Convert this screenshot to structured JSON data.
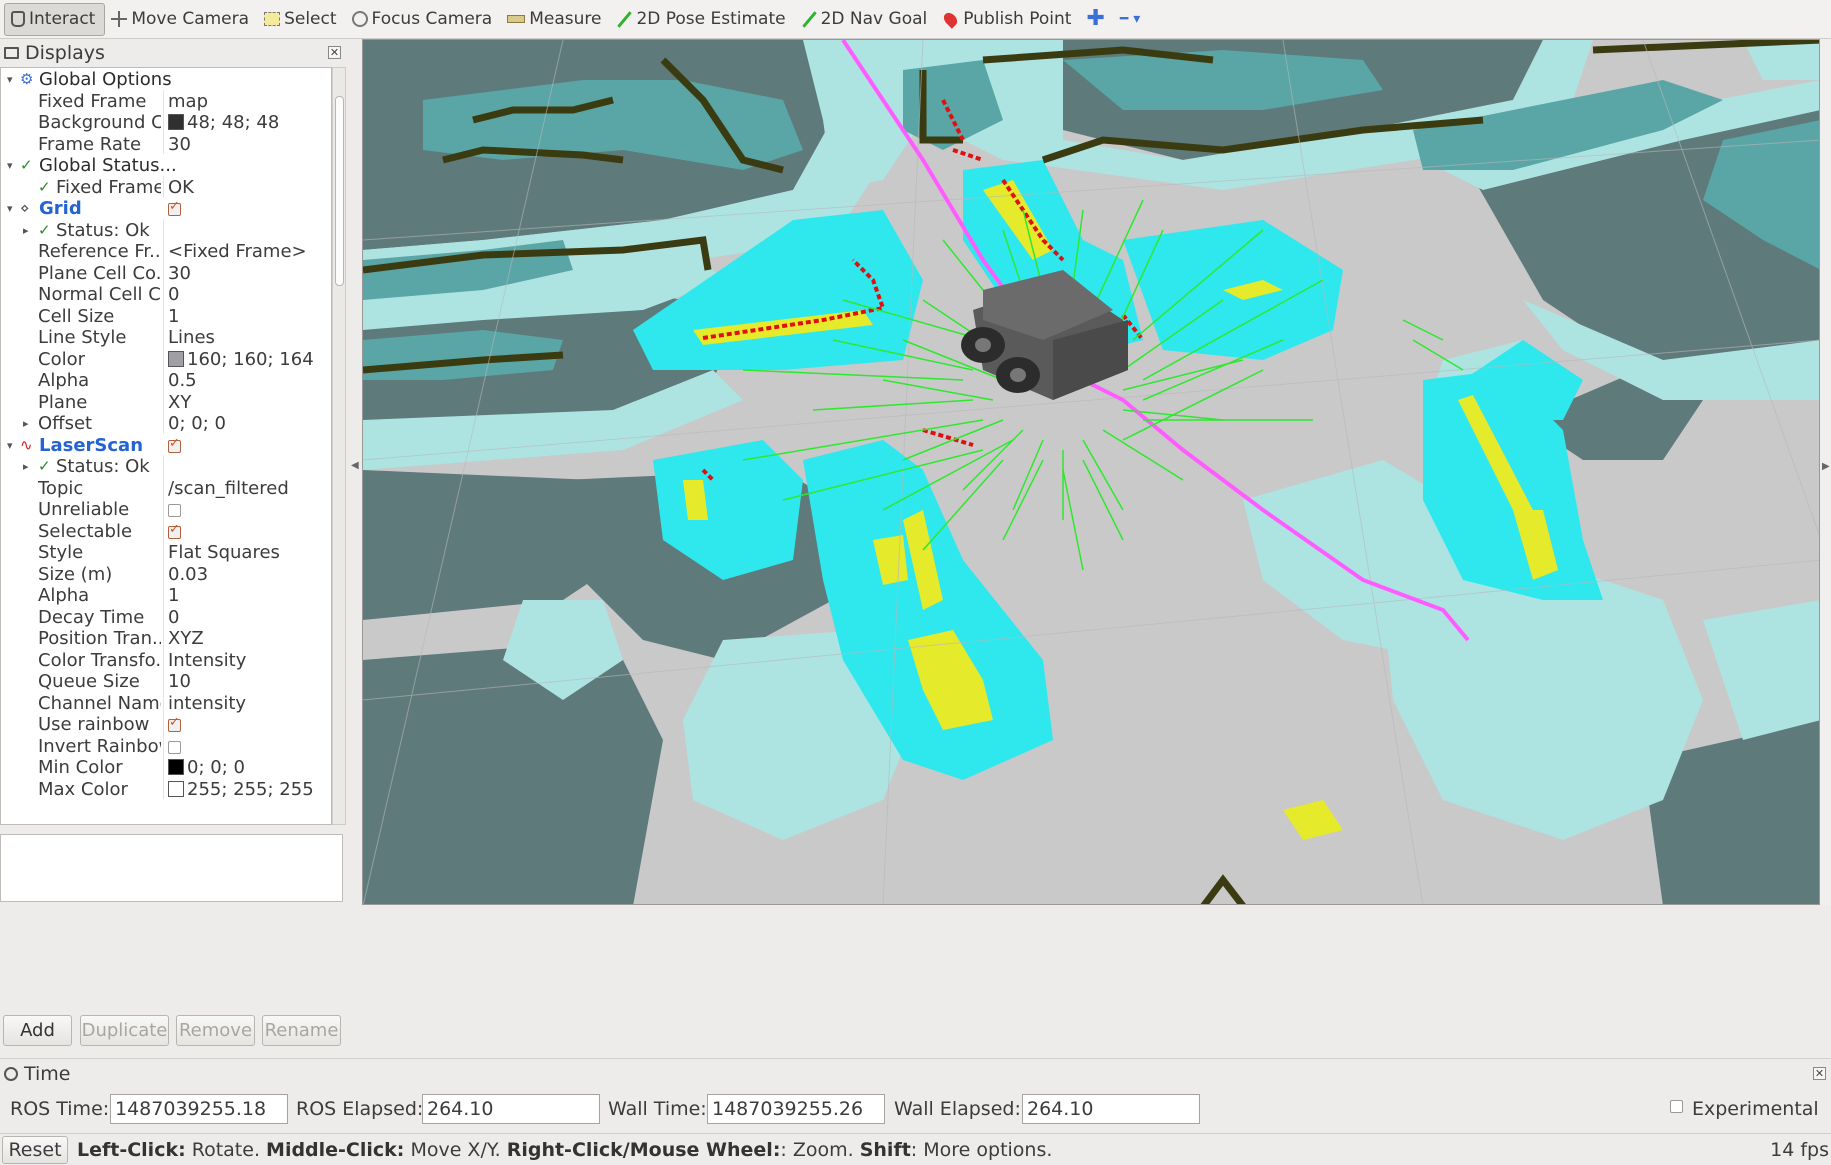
{
  "toolbar": {
    "tools": [
      {
        "label": "Interact",
        "icon": "hand-icon"
      },
      {
        "label": "Move Camera",
        "icon": "move-camera-icon"
      },
      {
        "label": "Select",
        "icon": "select-icon"
      },
      {
        "label": "Focus Camera",
        "icon": "focus-camera-icon"
      },
      {
        "label": "Measure",
        "icon": "measure-icon"
      },
      {
        "label": "2D Pose Estimate",
        "icon": "pose-arrow-icon"
      },
      {
        "label": "2D Nav Goal",
        "icon": "nav-goal-arrow-icon"
      },
      {
        "label": "Publish Point",
        "icon": "point-pin-icon"
      }
    ],
    "add_symbol": "✚",
    "remove_symbol": "━ ▾"
  },
  "displays": {
    "title": "Displays",
    "rows": [
      {
        "level": 0,
        "expanded": true,
        "icon": "⚙",
        "name": "Global Options",
        "value": ""
      },
      {
        "level": 1,
        "name": "Fixed Frame",
        "value": "map"
      },
      {
        "level": 1,
        "name": "Background C...",
        "swatch": "#303030",
        "value": "48; 48; 48"
      },
      {
        "level": 1,
        "name": "Frame Rate",
        "value": "30"
      },
      {
        "level": 0,
        "expanded": true,
        "icon": "✓",
        "name": "Global Status...",
        "value": ""
      },
      {
        "level": 1,
        "icon": "✓",
        "name": "Fixed Frame",
        "value": "OK"
      },
      {
        "level": 0,
        "expanded": true,
        "icon": "⋄",
        "name": "Grid",
        "blue": true,
        "checkbox": true
      },
      {
        "level": 1,
        "expandable": true,
        "icon": "✓",
        "name": "Status: Ok",
        "value": ""
      },
      {
        "level": 1,
        "name": "Reference Fr...",
        "value": "<Fixed Frame>"
      },
      {
        "level": 1,
        "name": "Plane Cell Co...",
        "value": "30"
      },
      {
        "level": 1,
        "name": "Normal Cell C...",
        "value": "0"
      },
      {
        "level": 1,
        "name": "Cell Size",
        "value": "1"
      },
      {
        "level": 1,
        "name": "Line Style",
        "value": "Lines"
      },
      {
        "level": 1,
        "name": "Color",
        "swatch": "#a0a0a4",
        "value": "160; 160; 164"
      },
      {
        "level": 1,
        "name": "Alpha",
        "value": "0.5"
      },
      {
        "level": 1,
        "name": "Plane",
        "value": "XY"
      },
      {
        "level": 1,
        "expandable": true,
        "name": "Offset",
        "value": "0; 0; 0"
      },
      {
        "level": 0,
        "expanded": true,
        "icon": "∿",
        "name": "LaserScan",
        "blue": true,
        "checkbox": true
      },
      {
        "level": 1,
        "expandable": true,
        "icon": "✓",
        "name": "Status: Ok",
        "value": ""
      },
      {
        "level": 1,
        "name": "Topic",
        "value": "/scan_filtered"
      },
      {
        "level": 1,
        "name": "Unreliable",
        "checkbox": false
      },
      {
        "level": 1,
        "name": "Selectable",
        "checkbox": true
      },
      {
        "level": 1,
        "name": "Style",
        "value": "Flat Squares"
      },
      {
        "level": 1,
        "name": "Size (m)",
        "value": "0.03"
      },
      {
        "level": 1,
        "name": "Alpha",
        "value": "1"
      },
      {
        "level": 1,
        "name": "Decay Time",
        "value": "0"
      },
      {
        "level": 1,
        "name": "Position Tran...",
        "value": "XYZ"
      },
      {
        "level": 1,
        "name": "Color Transfo...",
        "value": "Intensity"
      },
      {
        "level": 1,
        "name": "Queue Size",
        "value": "10"
      },
      {
        "level": 1,
        "name": "Channel Name",
        "value": "intensity"
      },
      {
        "level": 1,
        "name": "Use rainbow",
        "checkbox": true
      },
      {
        "level": 1,
        "name": "Invert Rainbow",
        "checkbox": false
      },
      {
        "level": 1,
        "name": "Min Color",
        "swatch": "#000000",
        "value": "0; 0; 0"
      },
      {
        "level": 1,
        "name": "Max Color",
        "swatch": "#ffffff",
        "value": "255; 255; 255"
      }
    ],
    "buttons": {
      "add": "Add",
      "duplicate": "Duplicate",
      "remove": "Remove",
      "rename": "Rename"
    }
  },
  "time": {
    "title": "Time",
    "ros_time_label": "ROS Time:",
    "ros_time": "1487039255.18",
    "ros_elapsed_label": "ROS Elapsed:",
    "ros_elapsed": "264.10",
    "wall_time_label": "Wall Time:",
    "wall_time": "1487039255.26",
    "wall_elapsed_label": "Wall Elapsed:",
    "wall_elapsed": "264.10",
    "experimental_label": "Experimental"
  },
  "status": {
    "reset": "Reset",
    "hint_parts": [
      {
        "b": "Left-Click:",
        "t": " Rotate. "
      },
      {
        "b": "Middle-Click:",
        "t": " Move X/Y. "
      },
      {
        "b": "Right-Click/Mouse Wheel:",
        "t": ": Zoom. "
      },
      {
        "b": "Shift",
        "t": ": More options."
      }
    ],
    "fps": "14 fps"
  },
  "colors": {
    "map_free": "#c8c8c8",
    "map_unknown": "#5f7b7b",
    "map_inflation_light": "#aee5e3",
    "map_inflation_teal": "#5fa7a7",
    "costmap_cyan": "#2ee8ee",
    "costmap_yellow": "#e7ec2a",
    "wall_dark": "#3a3a14",
    "laser_red": "#e01010",
    "path_magenta": "#ff5cff",
    "particles_green": "#2ee82e",
    "robot": "#555555"
  }
}
